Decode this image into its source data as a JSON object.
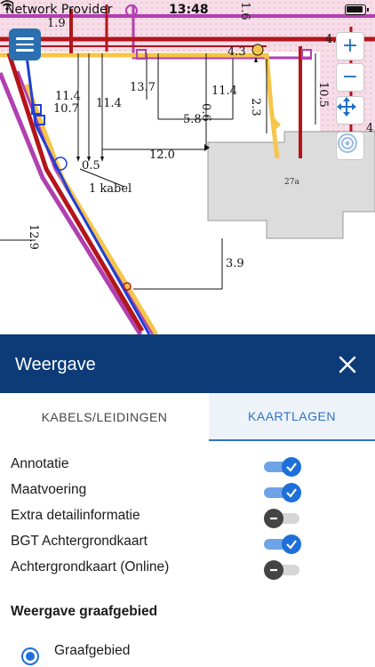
{
  "status_bar": {
    "carrier": "Network Provider",
    "time": "13:48"
  },
  "map": {
    "labels": {
      "m1": "11.4",
      "m2": "10.7",
      "m3": "11.4",
      "m4": "13.7",
      "m5": "0.6",
      "m6": "11.4",
      "m7": "5.8",
      "m8": "2.3",
      "m9": "10.5",
      "m10": "4.3",
      "m11": "12.0",
      "m12": "0.5",
      "m13": "1 kabel",
      "m14": "12.9",
      "m15": "3.9",
      "m16": "27a",
      "m17": "1.9",
      "m18": "1.6",
      "m19": "4.",
      "m20": "4."
    },
    "controls": {
      "zoom_in": "+",
      "zoom_out": "−"
    },
    "colors": {
      "red_cable": "#b3151b",
      "yellow_cable": "#f6c64a",
      "purple_cable": "#b040b0",
      "blue_cable": "#1f3fd6",
      "building": "#dcdcdc"
    }
  },
  "panel": {
    "title": "Weergave",
    "tabs": [
      {
        "label": "KABELS/LEIDINGEN",
        "active": false
      },
      {
        "label": "KAARTLAGEN",
        "active": true
      }
    ],
    "layers": [
      {
        "label": "Annotatie",
        "enabled": true
      },
      {
        "label": "Maatvoering",
        "enabled": true
      },
      {
        "label": "Extra detailinformatie",
        "enabled": false
      },
      {
        "label": "BGT Achtergrondkaart",
        "enabled": true
      },
      {
        "label": "Achtergrondkaart (Online)",
        "enabled": false
      }
    ],
    "section_title": "Weergave graafgebied",
    "radio_option": "Graafgebied"
  }
}
